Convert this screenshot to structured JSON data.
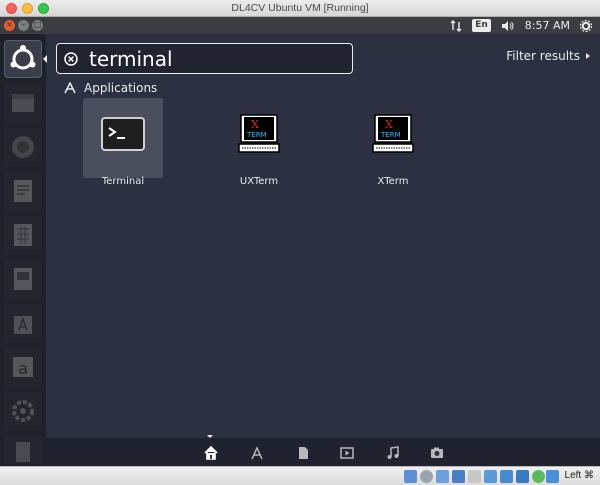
{
  "window": {
    "title": "DL4CV Ubuntu VM [Running]"
  },
  "panel": {
    "keyboard_layout": "En",
    "time": "8:57 AM"
  },
  "search": {
    "query": "terminal",
    "filter_label": "Filter results"
  },
  "section": {
    "title": "Applications"
  },
  "apps": [
    {
      "label": "Terminal",
      "icon": "terminal-icon",
      "selected": true
    },
    {
      "label": "UXTerm",
      "icon": "xterm-icon",
      "selected": false
    },
    {
      "label": "XTerm",
      "icon": "xterm-icon",
      "selected": false
    }
  ],
  "lenses": [
    "home-icon",
    "applications-icon",
    "files-icon",
    "video-icon",
    "music-icon",
    "photo-icon"
  ],
  "launcher": [
    "ubuntu-dash-icon",
    "file-manager-icon",
    "firefox-icon",
    "writer-icon",
    "calc-icon",
    "impress-icon",
    "software-center-icon",
    "amazon-icon",
    "settings-icon",
    "trash-icon"
  ],
  "vbox": {
    "host_key": "Left ⌘"
  },
  "colors": {
    "accent": "#e55b2c",
    "dash_bg": "#2c3040",
    "text": "#ececec"
  }
}
